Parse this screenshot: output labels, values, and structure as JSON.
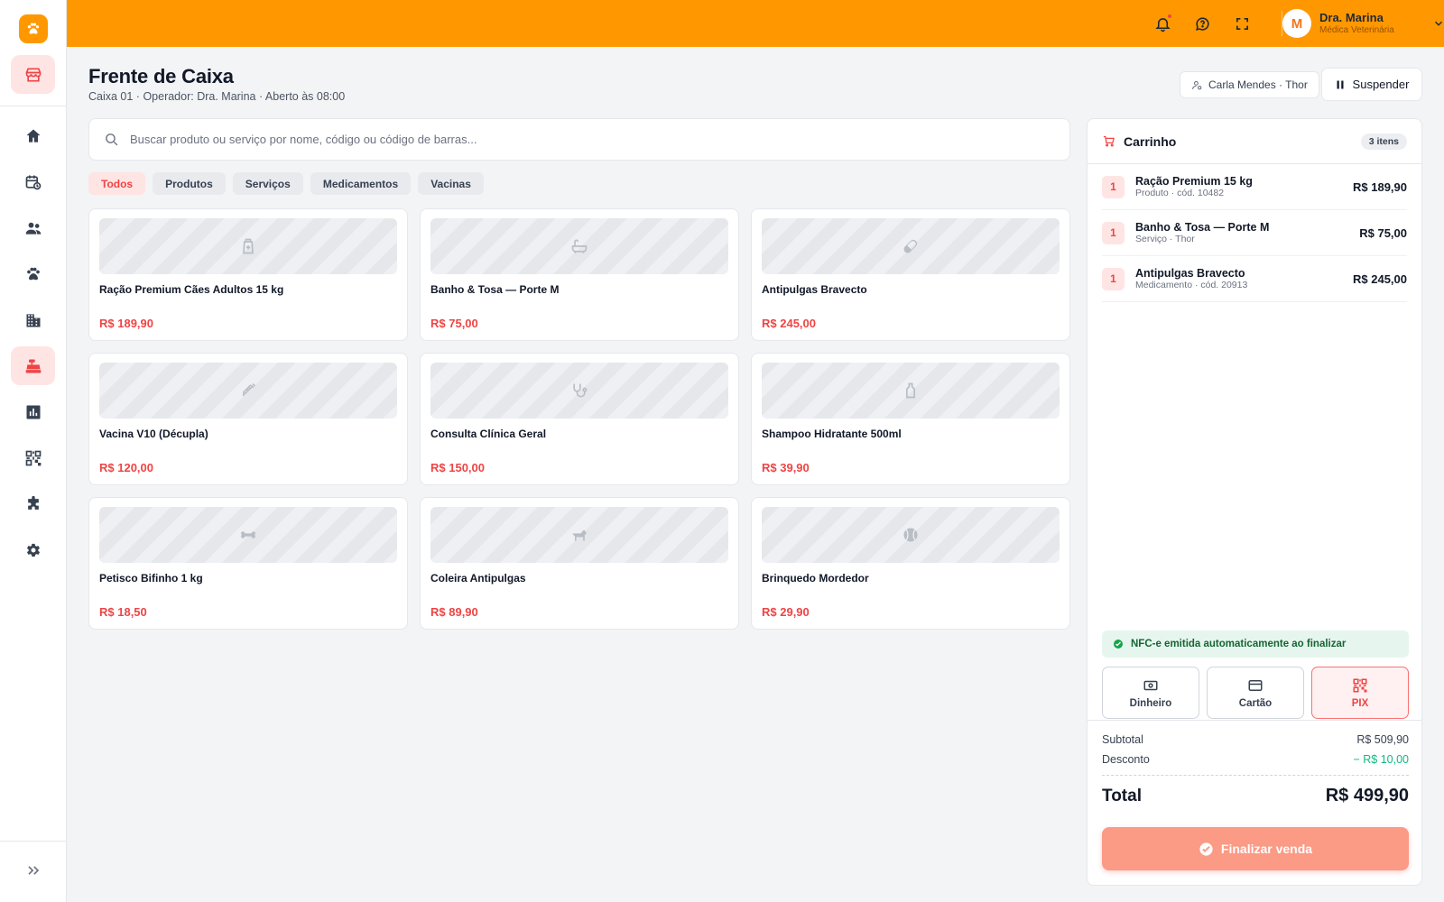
{
  "colors": {
    "brand": "#ff9800",
    "accent": "#ef4444",
    "success": "#10b981"
  },
  "topbar": {
    "notifications_icon": "bell-icon",
    "help_icon": "chat-help-icon",
    "fullscreen_icon": "fullscreen-icon",
    "user": {
      "initial": "M",
      "name": "Dra. Marina",
      "role": "Médica Veterinária"
    }
  },
  "sidebar": {
    "items": [
      {
        "icon": "store-icon"
      },
      {
        "icon": "home-icon"
      },
      {
        "icon": "calendar-clock-icon"
      },
      {
        "icon": "people-icon"
      },
      {
        "icon": "paw-icon"
      },
      {
        "icon": "building-icon"
      },
      {
        "icon": "cash-register-icon"
      },
      {
        "icon": "report-chart-icon"
      },
      {
        "icon": "qr-code-icon"
      },
      {
        "icon": "puzzle-icon"
      },
      {
        "icon": "gear-icon"
      },
      {
        "icon": "expand-double-chevron-icon"
      }
    ]
  },
  "header": {
    "title": "Frente de Caixa",
    "subtitle": "Caixa 01 · Operador: Dra. Marina · Aberto às 08:00",
    "customer": "Carla Mendes · Thor",
    "suspend_label": "Suspender"
  },
  "search": {
    "placeholder": "Buscar produto ou serviço por nome, código ou código de barras...",
    "value": ""
  },
  "filters": [
    "Todos",
    "Produtos",
    "Serviços",
    "Medicamentos",
    "Vacinas"
  ],
  "products": [
    {
      "name": "Ração Premium Cães Adultos 15 kg",
      "price": "R$ 189,90",
      "icon": "food-bag-icon"
    },
    {
      "name": "Banho & Tosa — Porte M",
      "price": "R$ 75,00",
      "icon": "bathtub-icon"
    },
    {
      "name": "Antipulgas Bravecto",
      "price": "R$ 245,00",
      "icon": "pill-icon"
    },
    {
      "name": "Vacina V10 (Décupla)",
      "price": "R$ 120,00",
      "icon": "syringe-icon"
    },
    {
      "name": "Consulta Clínica Geral",
      "price": "R$ 150,00",
      "icon": "stethoscope-icon"
    },
    {
      "name": "Shampoo Hidratante 500ml",
      "price": "R$ 39,90",
      "icon": "bottle-icon"
    },
    {
      "name": "Petisco Bifinho 1 kg",
      "price": "R$ 18,50",
      "icon": "bone-icon"
    },
    {
      "name": "Coleira Antipulgas",
      "price": "R$ 89,90",
      "icon": "dog-icon"
    },
    {
      "name": "Brinquedo Mordedor",
      "price": "R$ 29,90",
      "icon": "ball-icon"
    }
  ],
  "cart": {
    "title": "Carrinho",
    "count": "3 itens",
    "items": [
      {
        "qty": "1",
        "name": "Ração Premium 15 kg",
        "meta": "Produto · cód. 10482",
        "price": "R$ 189,90"
      },
      {
        "qty": "1",
        "name": "Banho & Tosa — Porte M",
        "meta": "Serviço · Thor",
        "price": "R$ 75,00"
      },
      {
        "qty": "1",
        "name": "Antipulgas Bravecto",
        "meta": "Medicamento · cód. 20913",
        "price": "R$ 245,00"
      }
    ],
    "nfce": "NFC-e emitida automaticamente ao finalizar",
    "payments": [
      {
        "label": "Dinheiro",
        "icon": "cash-icon"
      },
      {
        "label": "Cartão",
        "icon": "credit-card-icon"
      },
      {
        "label": "PIX",
        "icon": "qr-code-icon",
        "selected": true
      }
    ],
    "subtotal_label": "Subtotal",
    "subtotal": "R$ 509,90",
    "discount_label": "Desconto",
    "discount": "− R$ 10,00",
    "total_label": "Total",
    "total": "R$ 499,90",
    "finish_label": "Finalizar venda"
  }
}
